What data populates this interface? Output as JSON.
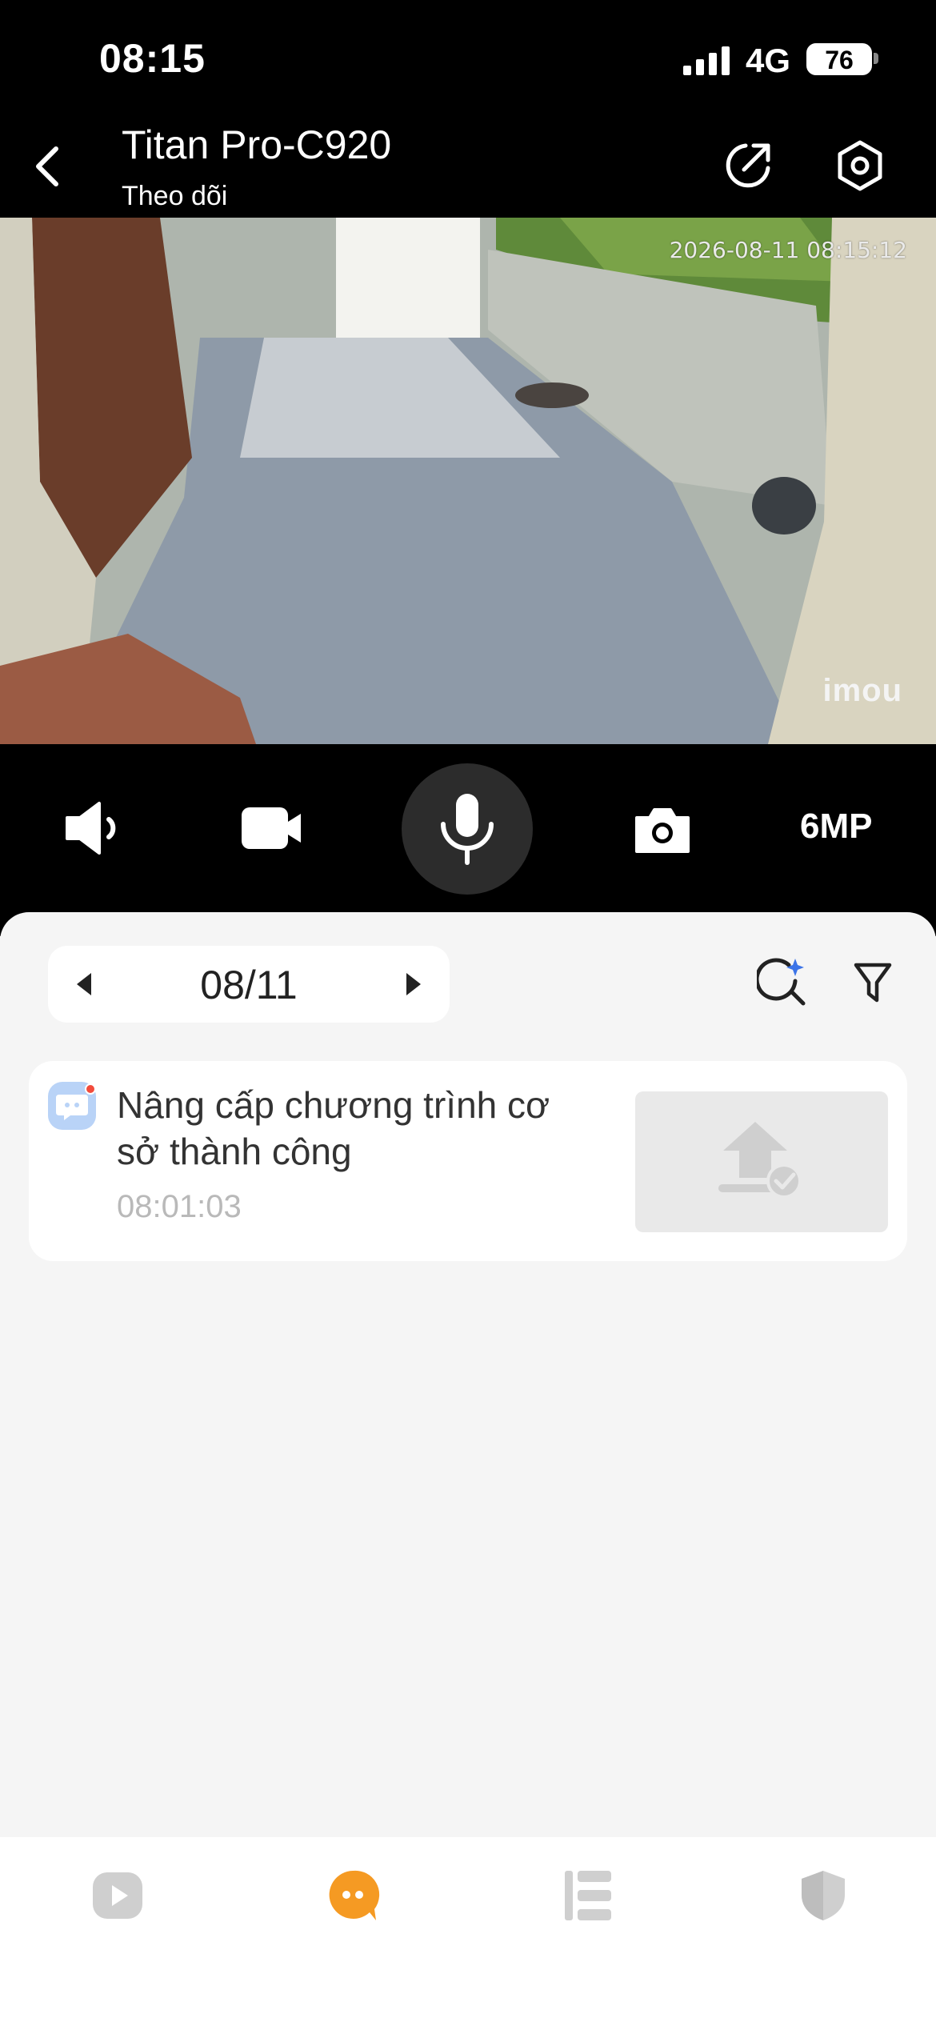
{
  "status_bar": {
    "time": "08:15",
    "network": "4G",
    "battery": "76"
  },
  "header": {
    "title": "Titan Pro-C920",
    "subtitle": "Theo dõi"
  },
  "video": {
    "timestamp": "2026-08-11 08:15:12",
    "logo": "imou"
  },
  "controls": {
    "resolution": "6MP"
  },
  "date_selector": {
    "date": "08/11"
  },
  "events": [
    {
      "title": "Nâng cấp chương trình cơ sở thành công",
      "time": "08:01:03"
    }
  ],
  "colors": {
    "accent": "#f59a23",
    "inactive_icon": "#cfcfcf",
    "event_avatar": "#b9d3f7",
    "notification_dot": "#f24b3b"
  },
  "icons": {
    "back": "chevron-left-icon",
    "share": "share-icon",
    "settings": "settings-icon",
    "speaker": "speaker-icon",
    "record": "video-camera-icon",
    "mic": "microphone-icon",
    "snapshot": "camera-icon",
    "ai_search": "ai-search-icon",
    "filter": "filter-icon",
    "nav": [
      "play-icon",
      "message-icon",
      "list-icon",
      "shield-icon"
    ]
  }
}
